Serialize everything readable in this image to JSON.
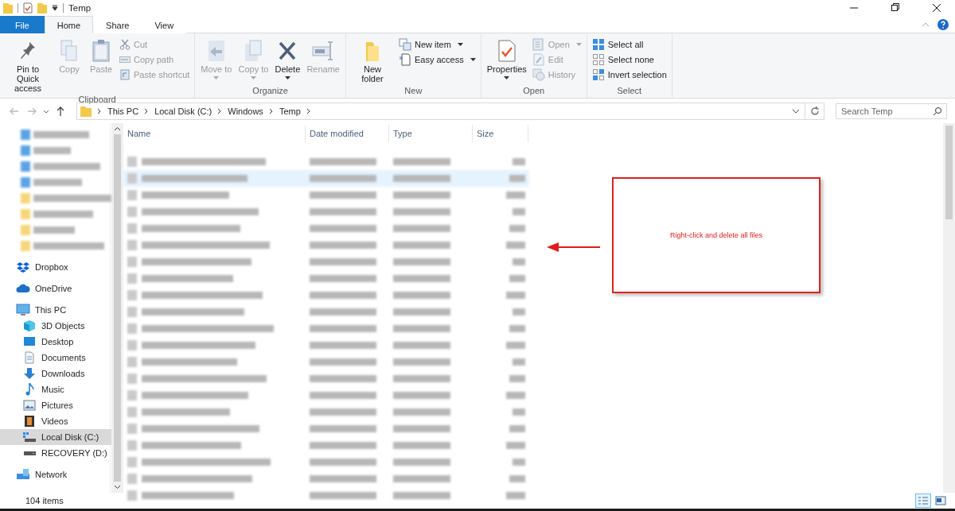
{
  "window": {
    "title": "Temp"
  },
  "ribbon_tabs": [
    {
      "label": "File",
      "kind": "file",
      "selected": false
    },
    {
      "label": "Home",
      "kind": "tab",
      "selected": true
    },
    {
      "label": "Share",
      "kind": "tab",
      "selected": false
    },
    {
      "label": "View",
      "kind": "tab",
      "selected": false
    }
  ],
  "ribbon_groups": [
    {
      "label": "Clipboard",
      "large": [
        {
          "label": "Pin to Quick access",
          "disabled": false,
          "dropdown": false
        },
        {
          "label": "Copy",
          "disabled": true,
          "dropdown": false
        },
        {
          "label": "Paste",
          "disabled": true,
          "dropdown": false
        }
      ],
      "small": [
        {
          "label": "Cut",
          "disabled": true,
          "dropdown": false
        },
        {
          "label": "Copy path",
          "disabled": true,
          "dropdown": false
        },
        {
          "label": "Paste shortcut",
          "disabled": true,
          "dropdown": false
        }
      ]
    },
    {
      "label": "Organize",
      "large": [
        {
          "label": "Move to",
          "disabled": true,
          "dropdown": true
        },
        {
          "label": "Copy to",
          "disabled": true,
          "dropdown": true
        },
        {
          "label": "Delete",
          "disabled": false,
          "dropdown": true
        },
        {
          "label": "Rename",
          "disabled": true,
          "dropdown": false
        }
      ]
    },
    {
      "label": "New",
      "large": [
        {
          "label": "New folder",
          "disabled": false,
          "dropdown": false
        }
      ],
      "small": [
        {
          "label": "New item",
          "disabled": false,
          "dropdown": true
        },
        {
          "label": "Easy access",
          "disabled": false,
          "dropdown": true
        }
      ]
    },
    {
      "label": "Open",
      "large": [
        {
          "label": "Properties",
          "disabled": false,
          "dropdown": true
        }
      ],
      "small": [
        {
          "label": "Open",
          "disabled": true,
          "dropdown": true
        },
        {
          "label": "Edit",
          "disabled": true,
          "dropdown": false
        },
        {
          "label": "History",
          "disabled": true,
          "dropdown": false
        }
      ]
    },
    {
      "label": "Select",
      "small": [
        {
          "label": "Select all",
          "disabled": false,
          "dropdown": false
        },
        {
          "label": "Select none",
          "disabled": false,
          "dropdown": false
        },
        {
          "label": "Invert selection",
          "disabled": false,
          "dropdown": false
        }
      ]
    }
  ],
  "address": {
    "breadcrumbs": [
      "This PC",
      "Local Disk (C:)",
      "Windows",
      "Temp"
    ]
  },
  "search": {
    "placeholder": "Search Temp"
  },
  "navigation": [
    {
      "label": "Dropbox",
      "selected": false
    },
    {
      "label": "OneDrive",
      "selected": false
    },
    {
      "label": "This PC",
      "selected": false,
      "children": [
        {
          "label": "3D Objects",
          "selected": false
        },
        {
          "label": "Desktop",
          "selected": false
        },
        {
          "label": "Documents",
          "selected": false
        },
        {
          "label": "Downloads",
          "selected": false
        },
        {
          "label": "Music",
          "selected": false
        },
        {
          "label": "Pictures",
          "selected": false
        },
        {
          "label": "Videos",
          "selected": false
        },
        {
          "label": "Local Disk (C:)",
          "selected": true
        },
        {
          "label": "RECOVERY (D:)",
          "selected": false
        }
      ]
    },
    {
      "label": "Network",
      "selected": false
    }
  ],
  "columns": [
    "Name",
    "Date modified",
    "Type",
    "Size"
  ],
  "rows": [
    {
      "highlighted": false
    },
    {
      "highlighted": true
    },
    {
      "highlighted": false
    },
    {
      "highlighted": false
    },
    {
      "highlighted": false
    },
    {
      "highlighted": false
    },
    {
      "highlighted": false
    },
    {
      "highlighted": false
    },
    {
      "highlighted": false
    },
    {
      "highlighted": false
    },
    {
      "highlighted": false
    },
    {
      "highlighted": false
    },
    {
      "highlighted": false
    },
    {
      "highlighted": false
    },
    {
      "highlighted": false
    },
    {
      "highlighted": false
    },
    {
      "highlighted": false
    },
    {
      "highlighted": false
    },
    {
      "highlighted": false
    },
    {
      "highlighted": false
    },
    {
      "highlighted": false
    }
  ],
  "annotation": {
    "text": "Right-click and delete all files"
  },
  "status_bar": {
    "count": "104 items",
    "views": [
      {
        "kind": "details",
        "selected": true
      },
      {
        "kind": "large",
        "selected": false
      }
    ]
  }
}
